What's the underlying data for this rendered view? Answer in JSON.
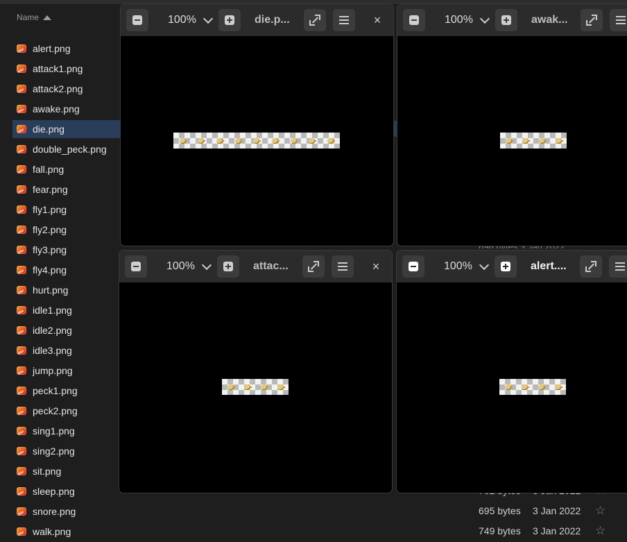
{
  "file_list": {
    "column_header": "Name",
    "files": [
      {
        "name": "alert.png"
      },
      {
        "name": "attack1.png"
      },
      {
        "name": "attack2.png"
      },
      {
        "name": "awake.png"
      },
      {
        "name": "die.png",
        "selected": true
      },
      {
        "name": "double_peck.png"
      },
      {
        "name": "fall.png"
      },
      {
        "name": "fear.png"
      },
      {
        "name": "fly1.png"
      },
      {
        "name": "fly2.png"
      },
      {
        "name": "fly3.png"
      },
      {
        "name": "fly4.png"
      },
      {
        "name": "hurt.png"
      },
      {
        "name": "idle1.png"
      },
      {
        "name": "idle2.png"
      },
      {
        "name": "idle3.png"
      },
      {
        "name": "jump.png"
      },
      {
        "name": "peck1.png"
      },
      {
        "name": "peck2.png"
      },
      {
        "name": "sing1.png"
      },
      {
        "name": "sing2.png"
      },
      {
        "name": "sit.png"
      },
      {
        "name": "sleep.png"
      },
      {
        "name": "snore.png"
      },
      {
        "name": "walk.png"
      }
    ],
    "visible_meta": [
      {
        "size": "762 bytes",
        "date": "3 Jan 2022"
      },
      {
        "size": "695 bytes",
        "date": "3 Jan 2022"
      },
      {
        "size": "749 bytes",
        "date": "3 Jan 2022"
      }
    ],
    "partial_meta_text": "696 bytes   3 Jan 2022",
    "star_glyph": "☆"
  },
  "viewers": [
    {
      "title": "die.p...",
      "zoom": "100%",
      "close": "×",
      "active": false
    },
    {
      "title": "awak...",
      "zoom": "100%",
      "active": false
    },
    {
      "title": "attac...",
      "zoom": "100%",
      "close": "×",
      "active": false
    },
    {
      "title": "alert....",
      "zoom": "100%",
      "active": true
    }
  ],
  "colors": {
    "selection": "#2a3d59",
    "toolbar": "#2b2b2b",
    "button": "#3c3c3c",
    "canvas": "#000000"
  }
}
